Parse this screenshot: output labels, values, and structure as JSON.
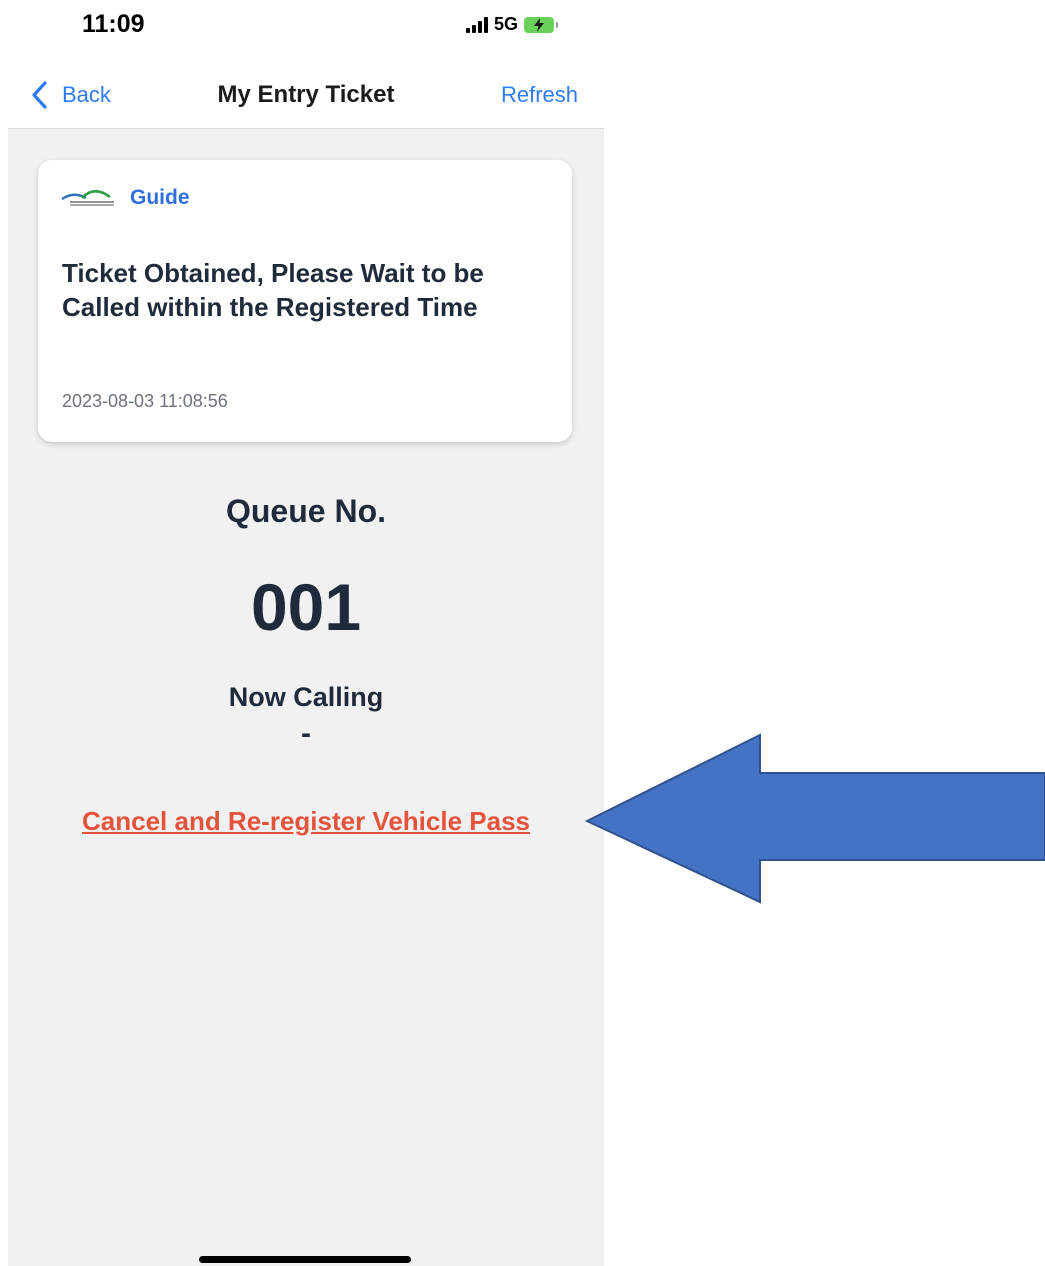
{
  "status_bar": {
    "time": "11:09",
    "network": "5G",
    "icons": [
      "signal-icon",
      "battery-charging-icon"
    ]
  },
  "nav": {
    "back_label": "Back",
    "title": "My Entry Ticket",
    "refresh_label": "Refresh"
  },
  "card": {
    "label": "Guide",
    "title": "Ticket Obtained, Please Wait to be Called within the Registered Time",
    "timestamp": "2023-08-03 11:08:56"
  },
  "queue": {
    "label": "Queue No.",
    "number": "001"
  },
  "now_calling": {
    "label": "Now Calling",
    "value": "-"
  },
  "cancel_link": "Cancel and Re-register Vehicle Pass",
  "colors": {
    "accent_blue": "#2f7bf5",
    "link_red": "#e5533d",
    "arrow_blue": "#4472c4",
    "content_bg": "#f1f1f1"
  }
}
